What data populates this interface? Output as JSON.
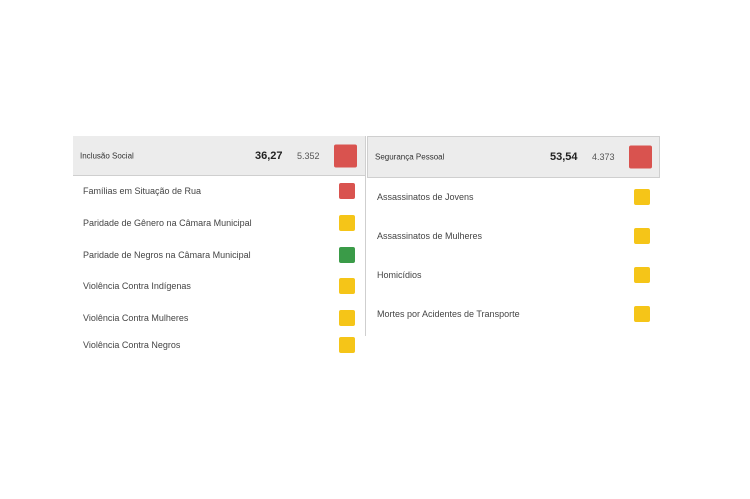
{
  "colors": {
    "red": "#d9534f",
    "yellow": "#f5c518",
    "green": "#3a9b48",
    "header_bg": "#ececec"
  },
  "left_panel": {
    "title": "Inclusão Social",
    "score": "36,27",
    "count": "5.352",
    "status": "red",
    "items": [
      {
        "label": "Famílias em Situação de Rua",
        "status": "red"
      },
      {
        "label": "Paridade de Gênero na Câmara Municipal",
        "status": "yellow"
      },
      {
        "label": "Paridade de Negros na Câmara Municipal",
        "status": "green"
      },
      {
        "label": "Violência Contra Indígenas",
        "status": "yellow"
      },
      {
        "label": "Violência Contra Mulheres",
        "status": "yellow"
      },
      {
        "label": "Violência Contra Negros",
        "status": "yellow"
      }
    ]
  },
  "right_panel": {
    "title": "Segurança Pessoal",
    "score": "53,54",
    "count": "4.373",
    "status": "red",
    "items": [
      {
        "label": "Assassinatos de Jovens",
        "status": "yellow"
      },
      {
        "label": "Assassinatos de Mulheres",
        "status": "yellow"
      },
      {
        "label": "Homicídios",
        "status": "yellow"
      },
      {
        "label": "Mortes por Acidentes de Transporte",
        "status": "yellow"
      }
    ]
  }
}
